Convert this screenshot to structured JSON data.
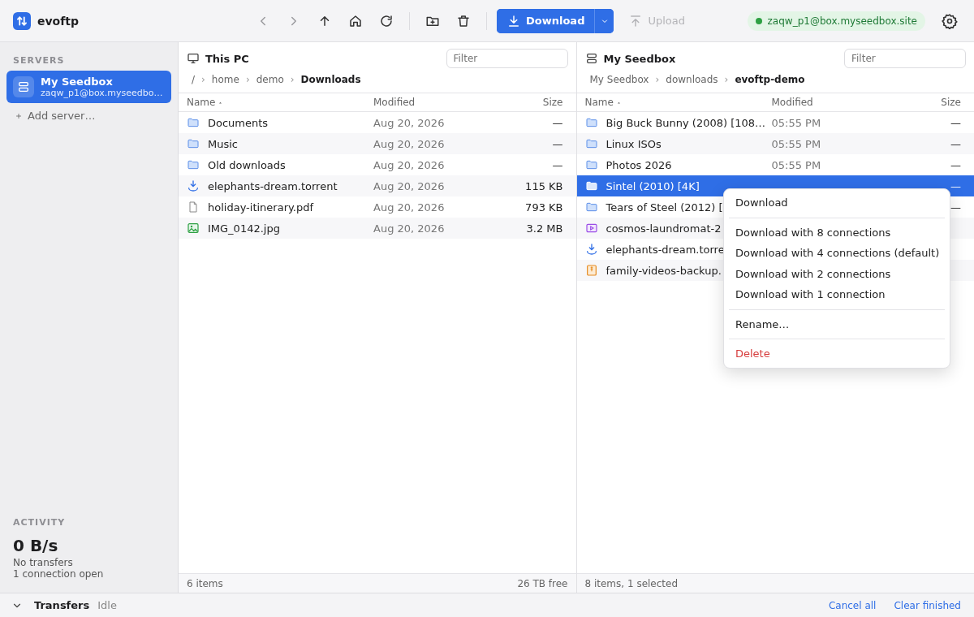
{
  "app": {
    "title": "evoftp"
  },
  "toolbar": {
    "download": {
      "label": "Download",
      "disabled": false
    },
    "upload": {
      "label": "Upload",
      "disabled": true
    },
    "connection": "zaqw_p1@box.myseedbox.site"
  },
  "sidebar": {
    "servers_heading": "SERVERS",
    "servers": [
      {
        "name": "My Seedbox",
        "address": "zaqw_p1@box.myseedbo…",
        "selected": true
      }
    ],
    "add_server": "Add server…",
    "activity_heading": "ACTIVITY",
    "speed": "0 B/s",
    "transfers": "No transfers",
    "connections": "1 connection open"
  },
  "panes": [
    {
      "kind": "local",
      "title": "This PC",
      "filter_placeholder": "Filter",
      "crumb_separator": "›",
      "breadcrumb": [
        "/",
        "home",
        "demo",
        "Downloads"
      ],
      "columns": [
        "Name",
        "Modified",
        "Size"
      ],
      "rows": [
        {
          "kind": "folder",
          "name": "Documents",
          "modified": "Aug 20, 2026",
          "size": "—",
          "selected": false
        },
        {
          "kind": "folder",
          "name": "Music",
          "modified": "Aug 20, 2026",
          "size": "—",
          "selected": false
        },
        {
          "kind": "folder",
          "name": "Old downloads",
          "modified": "Aug 20, 2026",
          "size": "—",
          "selected": false
        },
        {
          "kind": "torrent",
          "name": "elephants-dream.torrent",
          "modified": "Aug 20, 2026",
          "size": "115 KB",
          "selected": false
        },
        {
          "kind": "file",
          "name": "holiday-itinerary.pdf",
          "modified": "Aug 20, 2026",
          "size": "793 KB",
          "selected": false
        },
        {
          "kind": "image",
          "name": "IMG_0142.jpg",
          "modified": "Aug 20, 2026",
          "size": "3.2 MB",
          "selected": false
        }
      ],
      "status": "6 items",
      "free": "26 TB free"
    },
    {
      "kind": "remote",
      "title": "My Seedbox",
      "filter_placeholder": "Filter",
      "crumb_separator": "›",
      "breadcrumb": [
        "My Seedbox",
        "downloads",
        "evoftp-demo"
      ],
      "columns": [
        "Name",
        "Modified",
        "Size"
      ],
      "rows": [
        {
          "kind": "folder",
          "name": "Big Buck Bunny (2008) [108…",
          "modified": "05:55 PM",
          "size": "—",
          "selected": false
        },
        {
          "kind": "folder",
          "name": "Linux ISOs",
          "modified": "05:55 PM",
          "size": "—",
          "selected": false
        },
        {
          "kind": "folder",
          "name": "Photos 2026",
          "modified": "05:55 PM",
          "size": "—",
          "selected": false
        },
        {
          "kind": "folder",
          "name": "Sintel (2010) [4K]",
          "size": "—",
          "selected": true
        },
        {
          "kind": "folder",
          "name": "Tears of Steel (2012) [",
          "size": "—",
          "selected": false
        },
        {
          "kind": "video",
          "name": "cosmos-laundromat-2",
          "selected": false
        },
        {
          "kind": "torrent",
          "name": "elephants-dream.torre",
          "selected": false
        },
        {
          "kind": "archive",
          "name": "family-videos-backup.",
          "selected": false
        }
      ],
      "status": "8 items, 1 selected"
    }
  ],
  "context_menu": [
    {
      "kind": "item",
      "label": "Download"
    },
    {
      "kind": "separator"
    },
    {
      "kind": "item",
      "label": "Download with 8 connections"
    },
    {
      "kind": "item",
      "label": "Download with 4 connections (default)"
    },
    {
      "kind": "item",
      "label": "Download with 2 connections"
    },
    {
      "kind": "item",
      "label": "Download with 1 connection"
    },
    {
      "kind": "separator"
    },
    {
      "kind": "item",
      "label": "Rename…"
    },
    {
      "kind": "separator"
    },
    {
      "kind": "danger",
      "label": "Delete"
    }
  ],
  "transfers_bar": {
    "title": "Transfers",
    "state": "Idle",
    "actions": [
      "Cancel all",
      "Clear finished"
    ]
  }
}
